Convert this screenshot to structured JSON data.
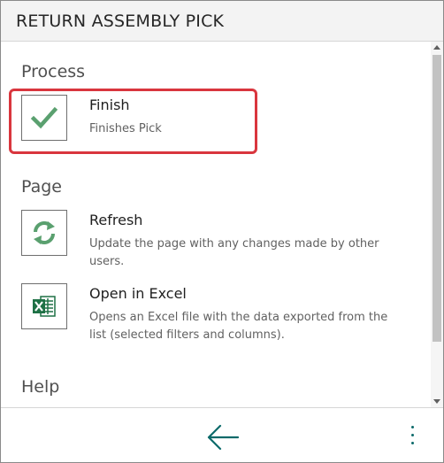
{
  "header": {
    "title": "RETURN ASSEMBLY PICK"
  },
  "sections": {
    "process": {
      "title": "Process",
      "actions": [
        {
          "label": "Finish",
          "description": "Finishes Pick",
          "icon": "checkmark-icon"
        }
      ]
    },
    "page": {
      "title": "Page",
      "actions": [
        {
          "label": "Refresh",
          "description": "Update the page with any changes made by other users.",
          "icon": "refresh-icon"
        },
        {
          "label": "Open in Excel",
          "description": "Opens an Excel file with the data exported from the list (selected filters and columns).",
          "icon": "excel-icon"
        }
      ]
    },
    "help": {
      "title": "Help"
    }
  },
  "footer": {
    "back_icon": "back-arrow-icon",
    "more_icon": "more-options-icon"
  },
  "colors": {
    "accent": "#0b6a6a",
    "highlight": "#d9363e",
    "icon_green": "#5aa06f",
    "excel_green": "#1e7145"
  }
}
